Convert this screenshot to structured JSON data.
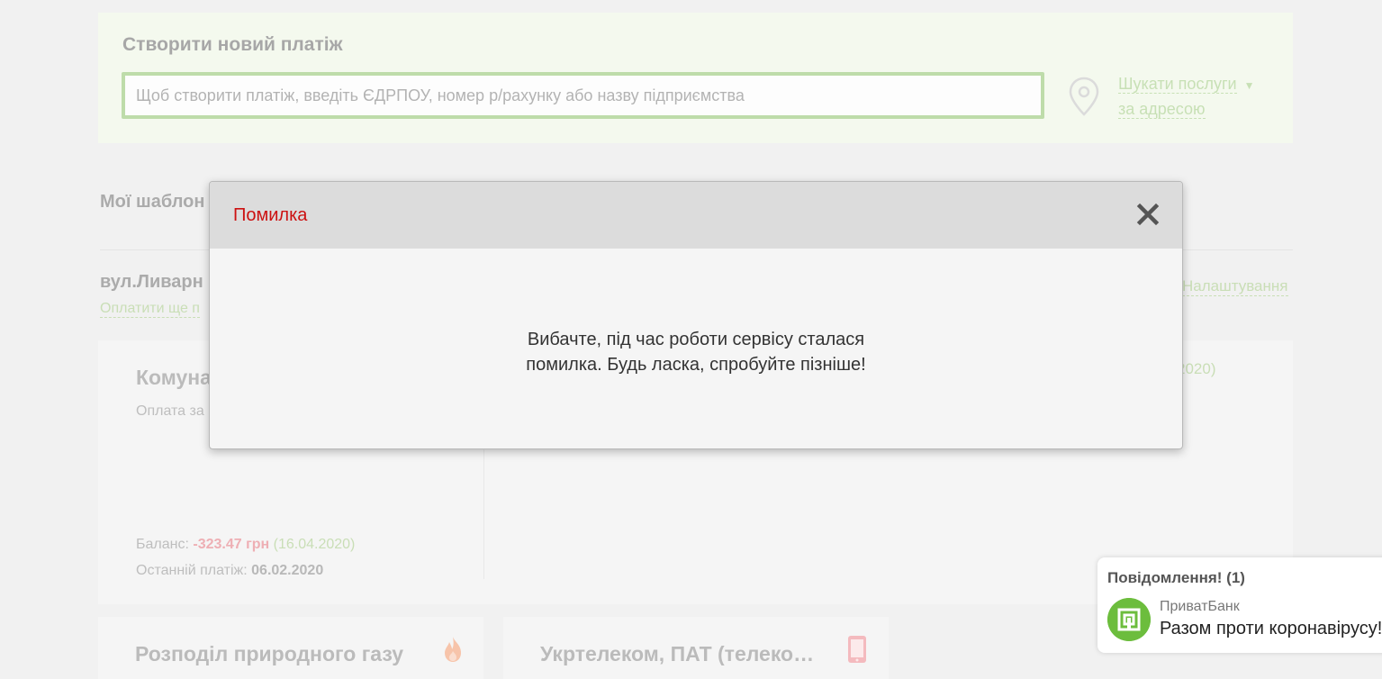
{
  "new_payment": {
    "title": "Створити новий платіж",
    "search_placeholder": "Щоб створити платіж, введіть ЄДРПОУ, номер р/рахунку або назву підприємства",
    "search_value": "",
    "address_search_line1": "Шукати послуги",
    "address_search_line2": "за адресою"
  },
  "templates": {
    "title": "Мої шаблон",
    "address_title": "вул.Ливарн",
    "pay_again_label": "Оплатити ще п",
    "settings_label": "Налаштування"
  },
  "utility_card": {
    "title": "Комуна",
    "subtitle": "Оплата за",
    "right_date": "2020)",
    "balance_label": "Баланс:",
    "balance_value": "-323.47 грн",
    "balance_date": "(16.04.2020)",
    "last_payment_label": "Останній платіж:",
    "last_payment_value": "06.02.2020"
  },
  "bottom_cards": [
    {
      "title": "Розподіл природного газу",
      "icon": "flame-icon"
    },
    {
      "title": "Укртелеком, ПАТ (телеко…",
      "icon": "phone-icon"
    }
  ],
  "modal": {
    "title": "Помилка",
    "message_line1": "Вибачте, під час роботи сервісу сталася",
    "message_line2": "помилка. Будь ласка, спробуйте пізніше!"
  },
  "notification": {
    "header": "Повідомлення! (1)",
    "sender": "ПриватБанк",
    "text": "Разом проти коронавірусу!"
  },
  "colors": {
    "accent_green": "#a9d18e",
    "error_red": "#cc1111",
    "balance_negative": "#e8949b",
    "privat_green": "#6cbd3d"
  }
}
